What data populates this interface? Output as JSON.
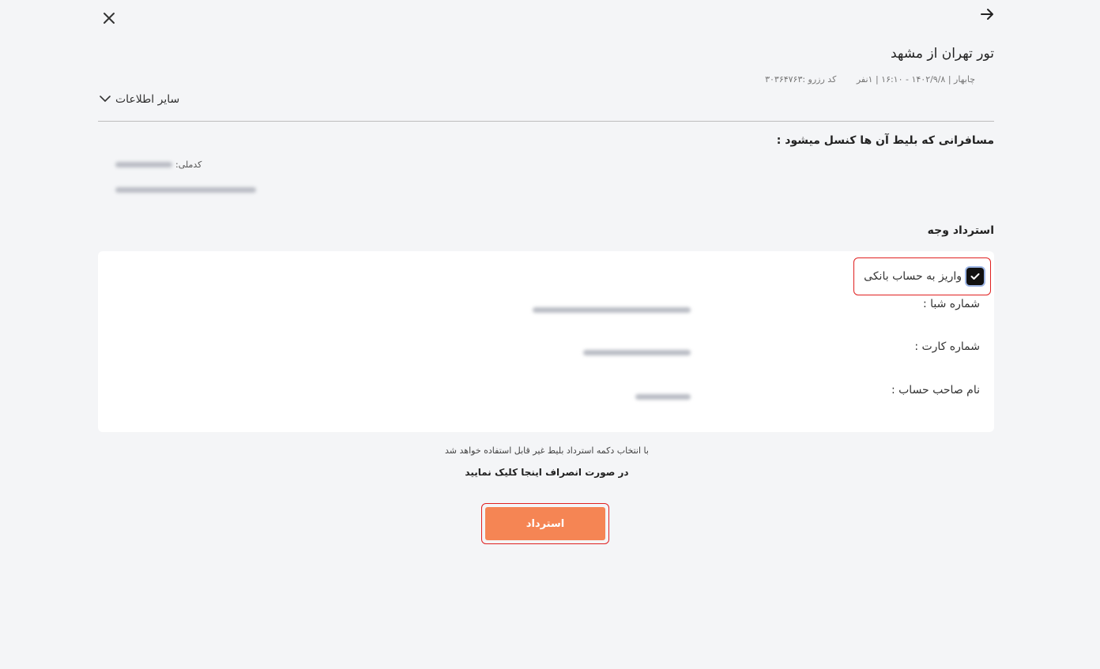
{
  "header": {
    "title": "تور تهران از مشهد",
    "trip_info": "چابهار | ۱۴۰۲/۹/۸ - ۱۶:۱۰ | ۱نفر",
    "reservation_code": "کد رزرو :۳۰۳۶۴۷۶۳",
    "more_info_label": "سایر اطلاعات"
  },
  "passengers": {
    "heading": "مسافرانی که بلیط آن ها کنسل میشود :",
    "national_id_label": "کدملی:"
  },
  "refund": {
    "heading": "استرداد وجه",
    "bank_option_label": "واریز به حساب بانکی",
    "bank_option_checked": true,
    "sheba_label": "شماره شبا :",
    "card_label": "شماره کارت :",
    "holder_label": "نام صاحب حساب :"
  },
  "notices": {
    "warning": "با انتخاب دکمه استرداد بلیط غیر قابل استفاده خواهد شد",
    "cancel_link": "در صورت انصراف اینجا کلیک نمایید"
  },
  "actions": {
    "refund_button": "استرداد"
  },
  "colors": {
    "accent": "#f58554",
    "highlight": "#e02020",
    "background": "#f4f5f7"
  }
}
